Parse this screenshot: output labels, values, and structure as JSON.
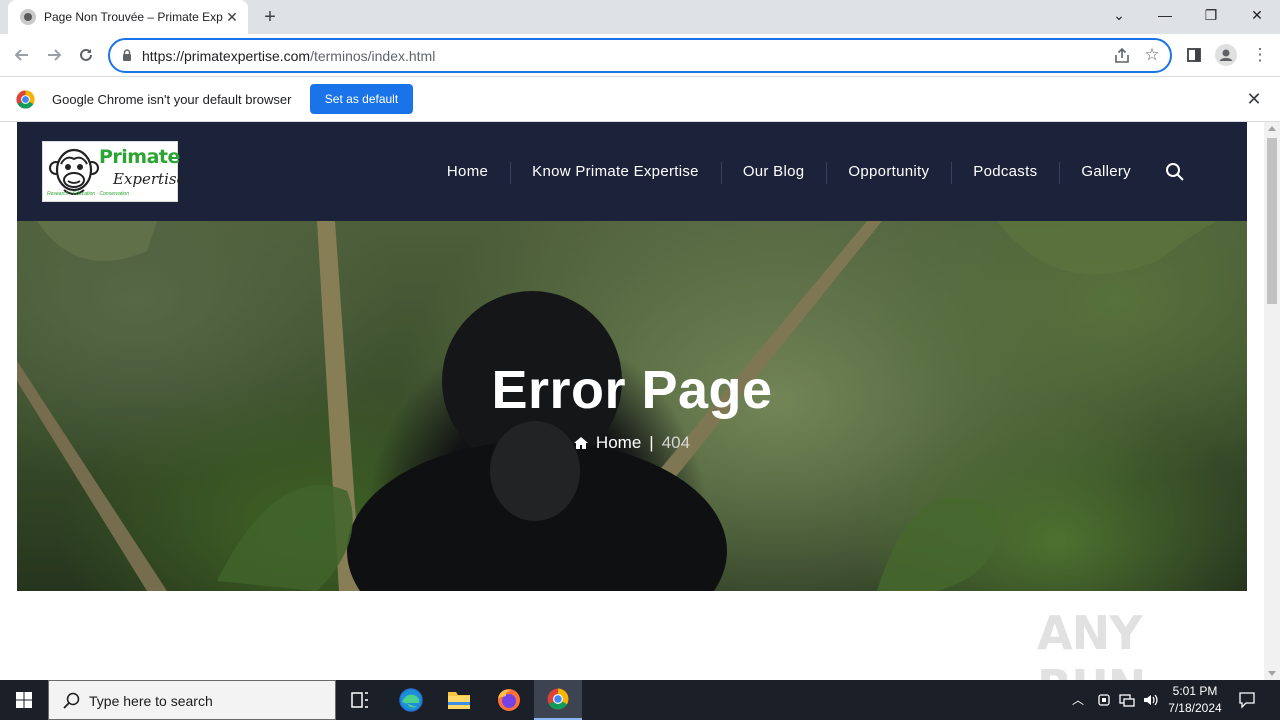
{
  "browser": {
    "tab_title": "Page Non Trouvée – Primate Exp",
    "new_tab_symbol": "+",
    "url_host": "https://primatexpertise.com",
    "url_path": "/terminos/index.html"
  },
  "infobar": {
    "message": "Google Chrome isn't your default browser",
    "button_label": "Set as default"
  },
  "site": {
    "logo": {
      "line1": "Primate",
      "line2": "Expertise",
      "tagline": "Research · Education · Conservation"
    },
    "nav": [
      "Home",
      "Know Primate Expertise",
      "Our Blog",
      "Opportunity",
      "Podcasts",
      "Gallery"
    ],
    "hero": {
      "title": "Error Page",
      "breadcrumb_home": "Home",
      "breadcrumb_sep": "|",
      "breadcrumb_current": "404"
    },
    "watermark": "ANY RUN"
  },
  "taskbar": {
    "search_placeholder": "Type here to search",
    "time": "5:01 PM",
    "date": "7/18/2024"
  },
  "colors": {
    "nav_bg": "#1b2239",
    "accent_blue": "#1a73e8",
    "logo_green": "#2aa532",
    "taskbar_bg": "#1b1f27"
  }
}
